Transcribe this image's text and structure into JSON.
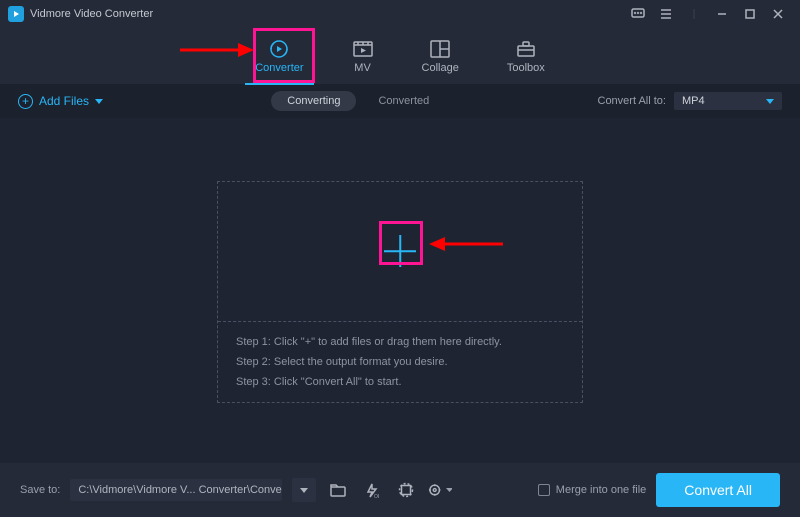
{
  "app": {
    "title": "Vidmore Video Converter"
  },
  "tabs": {
    "converter": "Converter",
    "mv": "MV",
    "collage": "Collage",
    "toolbox": "Toolbox"
  },
  "subbar": {
    "add_files": "Add Files",
    "converting": "Converting",
    "converted": "Converted",
    "convert_all_to_label": "Convert All to:",
    "format": "MP4"
  },
  "steps": {
    "s1": "Step 1: Click \"+\" to add files or drag them here directly.",
    "s2": "Step 2: Select the output format you desire.",
    "s3": "Step 3: Click \"Convert All\" to start."
  },
  "bottom": {
    "save_to_label": "Save to:",
    "save_to_path": "C:\\Vidmore\\Vidmore V... Converter\\Converted",
    "merge_label": "Merge into one file",
    "convert_all": "Convert All"
  },
  "colors": {
    "accent": "#29b6f6",
    "highlight": "#ff1493"
  }
}
